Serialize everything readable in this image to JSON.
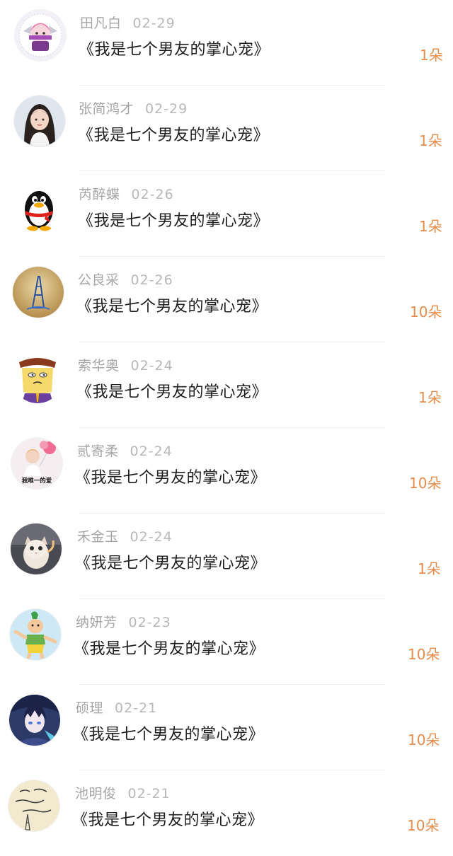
{
  "colors": {
    "name_text": "#a6a6a6",
    "title_text": "#1e1e1e",
    "count_text": "#e58c4b",
    "divider": "#efefef",
    "background": "#ffffff"
  },
  "entries": [
    {
      "name": "田凡白",
      "date": "02-29",
      "title": "《我是七个男友的掌心宠》",
      "count": "1朵",
      "avatar": "anime-girl-pink-avatar"
    },
    {
      "name": "张简鸿才",
      "date": "02-29",
      "title": "《我是七个男友的掌心宠》",
      "count": "1朵",
      "avatar": "girl-photo-avatar"
    },
    {
      "name": "芮醉蝶",
      "date": "02-26",
      "title": "《我是七个男友的掌心宠》",
      "count": "1朵",
      "avatar": "qq-penguin-avatar"
    },
    {
      "name": "公良采",
      "date": "02-26",
      "title": "《我是七个男友的掌心宠》",
      "count": "10朵",
      "avatar": "eiffel-tower-avatar"
    },
    {
      "name": "索华奥",
      "date": "02-24",
      "title": "《我是七个男友的掌心宠》",
      "count": "1朵",
      "avatar": "cartoon-man-avatar"
    },
    {
      "name": "贰寄柔",
      "date": "02-24",
      "title": "《我是七个男友的掌心宠》",
      "count": "10朵",
      "avatar": "girl-balloon-avatar",
      "avatar_caption": "我唯一的爱"
    },
    {
      "name": "禾金玉",
      "date": "02-24",
      "title": "《我是七个男友的掌心宠》",
      "count": "1朵",
      "avatar": "cat-photo-avatar"
    },
    {
      "name": "纳妍芳",
      "date": "02-23",
      "title": "《我是七个男友的掌心宠》",
      "count": "10朵",
      "avatar": "calabash-brother-avatar"
    },
    {
      "name": "硕理",
      "date": "02-21",
      "title": "《我是七个男友的掌心宠》",
      "count": "10朵",
      "avatar": "anime-boy-avatar"
    },
    {
      "name": "池明俊",
      "date": "02-21",
      "title": "《我是七个男友的掌心宠》",
      "count": "10朵",
      "avatar": "handwriting-tower-avatar"
    }
  ]
}
